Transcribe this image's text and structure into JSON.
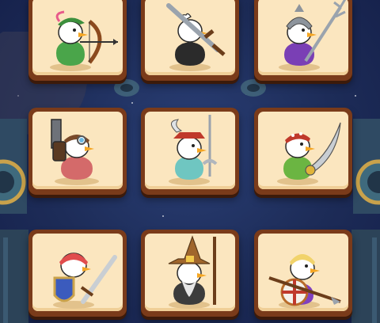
{
  "screen": {
    "background_color": "#1c2c57",
    "card_frame_color": "#7a3b1a",
    "card_face_color": "#fbe6bf"
  },
  "character_grid": {
    "cards": [
      {
        "id": "archer",
        "character": "archer-duck",
        "icon": "bow-icon",
        "row": 1,
        "col": 1
      },
      {
        "id": "swordsman",
        "character": "swordsman-duck",
        "icon": "sword-icon",
        "row": 1,
        "col": 2
      },
      {
        "id": "trident-knight",
        "character": "trident-knight-duck",
        "icon": "trident-icon",
        "row": 1,
        "col": 3
      },
      {
        "id": "gunner",
        "character": "gunner-duck",
        "icon": "gun-icon",
        "row": 2,
        "col": 1
      },
      {
        "id": "musketeer",
        "character": "musketeer-duck",
        "icon": "rapier-icon",
        "row": 2,
        "col": 2
      },
      {
        "id": "pirate",
        "character": "pirate-duck",
        "icon": "cutlass-icon",
        "row": 2,
        "col": 3
      },
      {
        "id": "knight",
        "character": "knight-duck",
        "icon": "shield-icon",
        "row": 3,
        "col": 1
      },
      {
        "id": "wizard",
        "character": "wizard-duck",
        "icon": "staff-icon",
        "row": 3,
        "col": 2
      },
      {
        "id": "spearman",
        "character": "spearman-duck",
        "icon": "spear-icon",
        "row": 3,
        "col": 3
      }
    ]
  }
}
